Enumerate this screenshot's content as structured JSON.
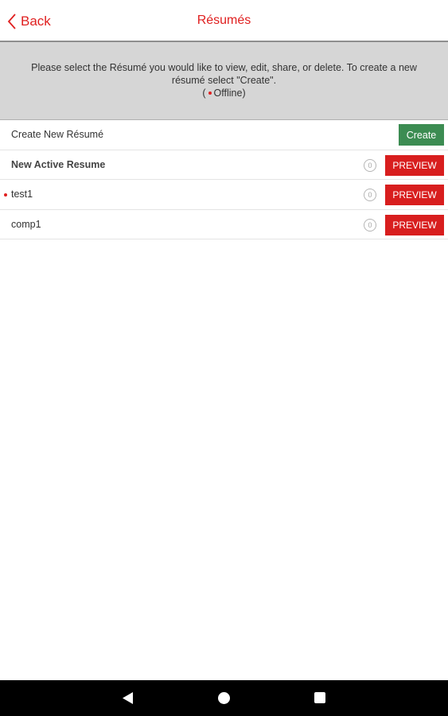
{
  "header": {
    "back_label": "Back",
    "title": "Résumés"
  },
  "info": {
    "message": "Please select the Résumé you would like to view, edit, share, or delete. To create a new résumé select \"Create\".",
    "status_open": "(",
    "status_label": "Offline)"
  },
  "create_row": {
    "label": "Create New Résumé",
    "button_label": "Create"
  },
  "resumes": [
    {
      "name": "New Active Resume",
      "count": "0",
      "preview_label": "PREVIEW",
      "offline": false
    },
    {
      "name": "test1",
      "count": "0",
      "preview_label": "PREVIEW",
      "offline": true
    },
    {
      "name": "comp1",
      "count": "0",
      "preview_label": "PREVIEW",
      "offline": false
    }
  ],
  "colors": {
    "accent": "#e02020",
    "create_green": "#3c8c52",
    "preview_red": "#d81e1e"
  },
  "navbar": {
    "icons": [
      "nav-back-icon",
      "nav-home-icon",
      "nav-recents-icon"
    ]
  }
}
